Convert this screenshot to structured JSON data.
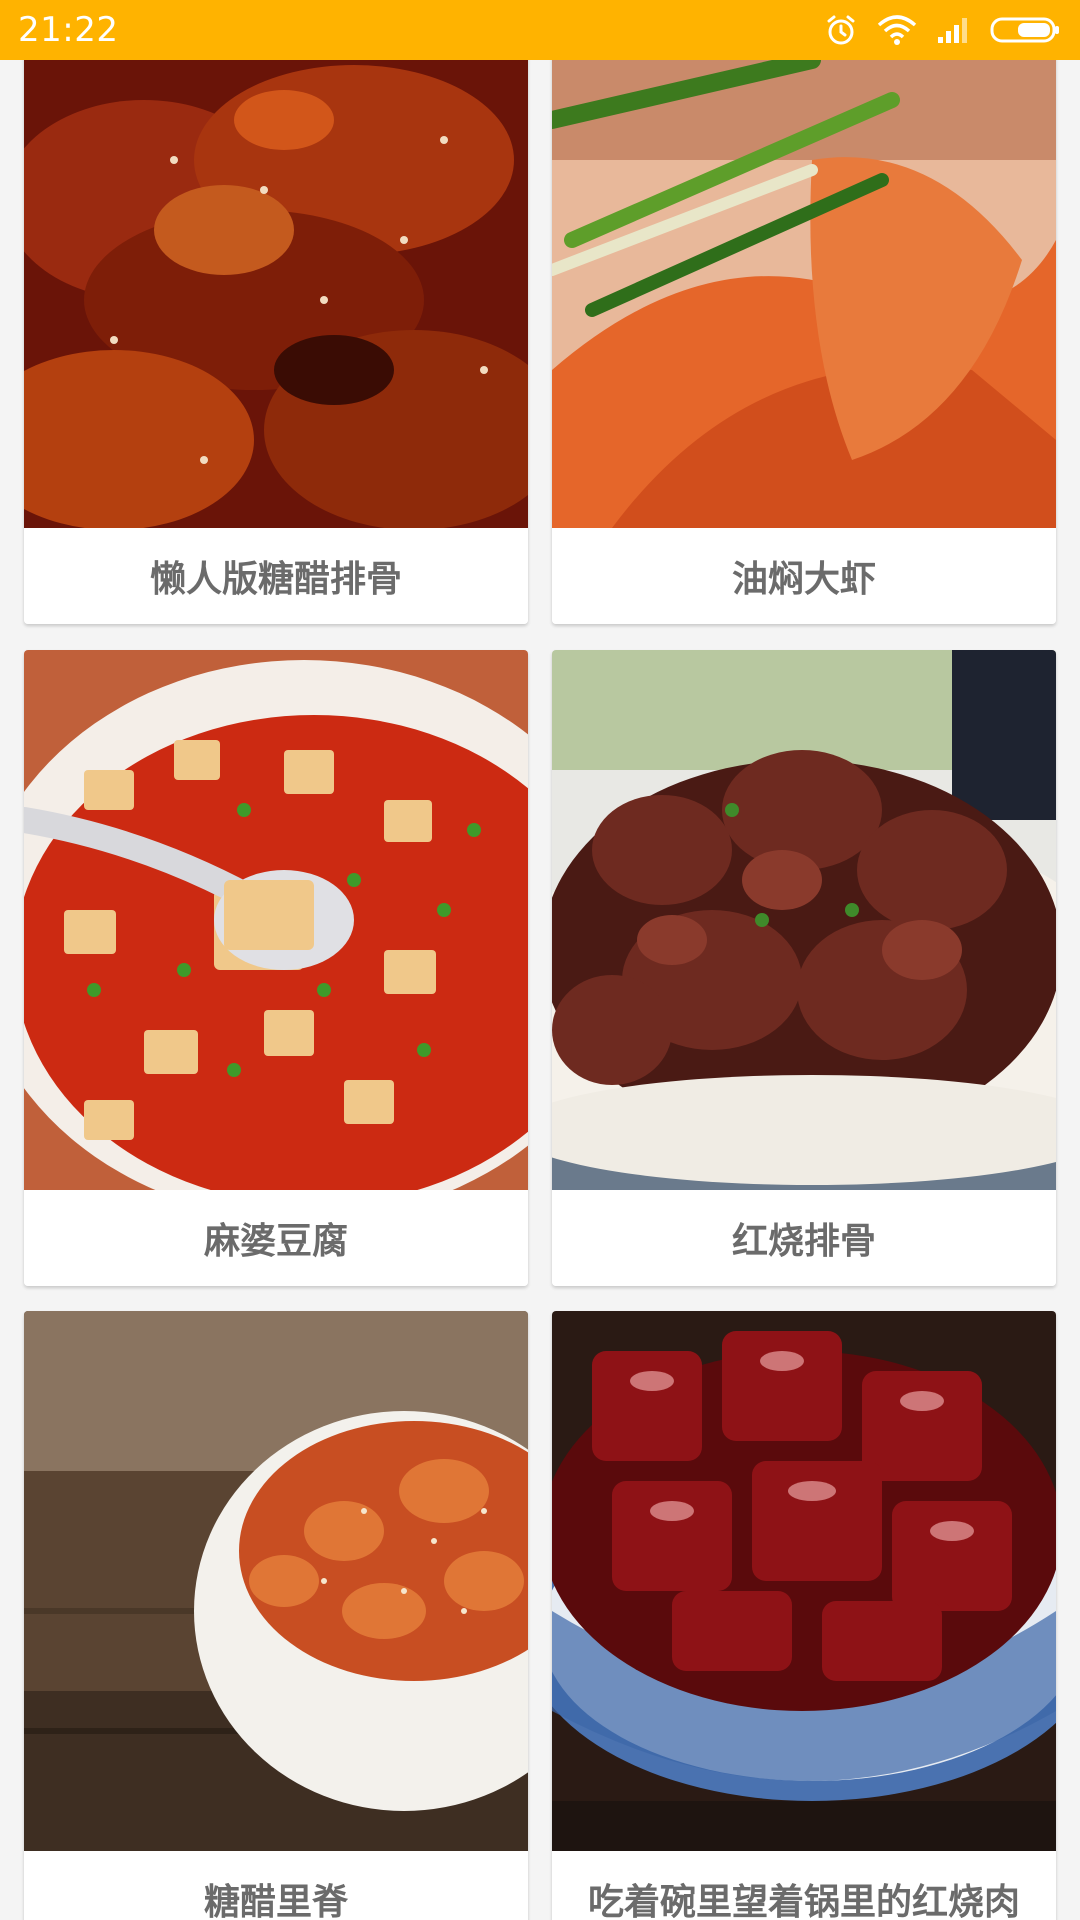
{
  "status_bar": {
    "time": "21:22",
    "icons": [
      "alarm-icon",
      "wifi-icon",
      "signal-icon",
      "battery-icon"
    ],
    "background": "#ffb300"
  },
  "recipes": [
    {
      "name": "懒人版糖醋排骨"
    },
    {
      "name": "油焖大虾"
    },
    {
      "name": "麻婆豆腐"
    },
    {
      "name": "红烧排骨"
    },
    {
      "name": "糖醋里脊"
    },
    {
      "name": "吃着碗里望着锅里的红烧肉"
    }
  ]
}
